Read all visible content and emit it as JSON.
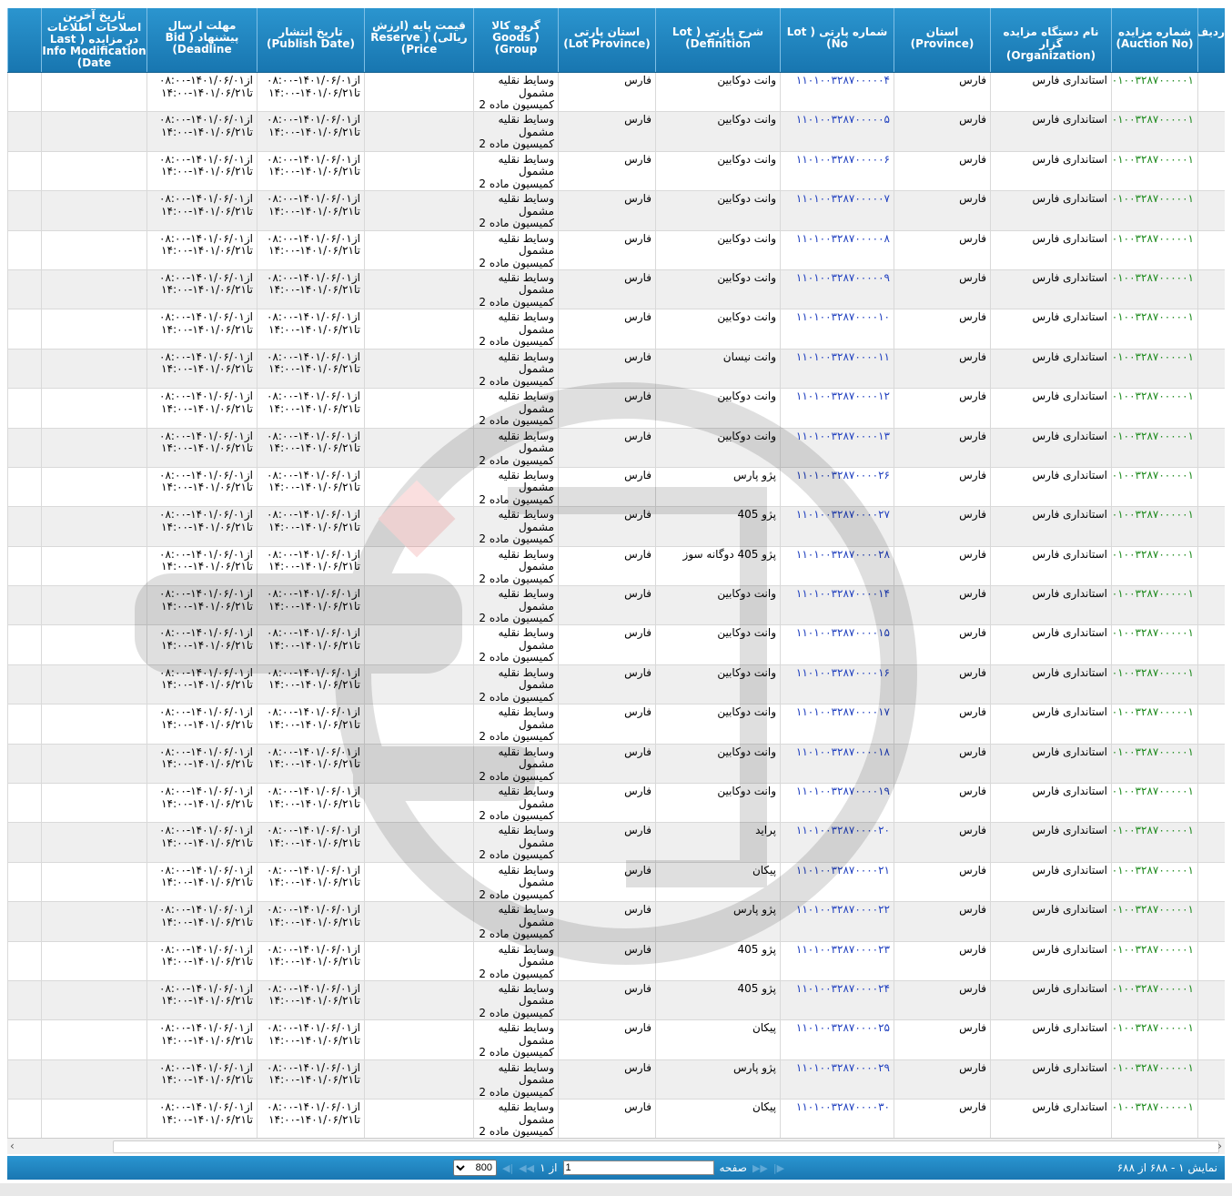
{
  "columns": [
    {
      "key": "row_no",
      "label": "ردیف",
      "width": 30
    },
    {
      "key": "auction_no",
      "label": "شماره مزایده\n(Auction No)",
      "width": 95
    },
    {
      "key": "organization",
      "label": "نام دستگاه مزایده گزار\n(Organization)",
      "width": 133
    },
    {
      "key": "province",
      "label": "استان\n(Province)",
      "width": 106
    },
    {
      "key": "lot_no",
      "label": "شماره پارتی ( Lot\nNo)",
      "width": 125
    },
    {
      "key": "definition",
      "label": "شرح پارتی ( Lot\nDefinition)",
      "width": 137
    },
    {
      "key": "lot_province",
      "label": "استان پارتی\n(Lot Province)",
      "width": 107
    },
    {
      "key": "goods_group",
      "label": "گروه کالا\n( Goods\nGroup)",
      "width": 93
    },
    {
      "key": "reserve_price",
      "label": "قیمت پایه (ارزش\nریالی) ( Reserve\nPrice)",
      "width": 120
    },
    {
      "key": "publish_date",
      "label": "تاریخ انتشار\n(Publish Date)",
      "width": 118
    },
    {
      "key": "deadline",
      "label": "مهلت ارسال\nپیشنهاد ( Bid\nDeadline)",
      "width": 121
    },
    {
      "key": "last_mod",
      "label": "تاریخ آخرین\nاصلاحات اطلاعات\nدر مزایده ( Last\nInfo Modification\nDate)",
      "width": 116
    },
    {
      "key": "extra",
      "label": "",
      "width": 37
    }
  ],
  "common": {
    "auction_no": "۱۰۰۱۰۰۳۲۸۷۰۰۰۰۰۱",
    "organization": "استانداری فارس",
    "province": "فارس",
    "lot_province": "فارس",
    "goods_group": "وسایط نقلیه\nمشمول\nکمیسیون ماده 2",
    "publish_date": "از۱۴۰۱/۰۶/۰۱-۰۸:۰۰\nتا۱۴۰۱/۰۶/۲۱-۱۴:۰۰",
    "deadline": "از۱۴۰۱/۰۶/۰۱-۰۸:۰۰\nتا۱۴۰۱/۰۶/۲۱-۱۴:۰۰"
  },
  "rows": [
    {
      "lot_no": "۱۱۰۱۰۰۳۲۸۷۰۰۰۰۰۴",
      "definition": "وانت دوکابین"
    },
    {
      "lot_no": "۱۱۰۱۰۰۳۲۸۷۰۰۰۰۰۵",
      "definition": "وانت دوکابین"
    },
    {
      "lot_no": "۱۱۰۱۰۰۳۲۸۷۰۰۰۰۰۶",
      "definition": "وانت دوکابین"
    },
    {
      "lot_no": "۱۱۰۱۰۰۳۲۸۷۰۰۰۰۰۷",
      "definition": "وانت دوکابین"
    },
    {
      "lot_no": "۱۱۰۱۰۰۳۲۸۷۰۰۰۰۰۸",
      "definition": "وانت دوکابین"
    },
    {
      "lot_no": "۱۱۰۱۰۰۳۲۸۷۰۰۰۰۰۹",
      "definition": "وانت دوکابین"
    },
    {
      "lot_no": "۱۱۰۱۰۰۳۲۸۷۰۰۰۰۱۰",
      "definition": "وانت دوکابین"
    },
    {
      "lot_no": "۱۱۰۱۰۰۳۲۸۷۰۰۰۰۱۱",
      "definition": "وانت نیسان"
    },
    {
      "lot_no": "۱۱۰۱۰۰۳۲۸۷۰۰۰۰۱۲",
      "definition": "وانت دوکابین"
    },
    {
      "lot_no": "۱۱۰۱۰۰۳۲۸۷۰۰۰۰۱۳",
      "definition": "وانت دوکابین"
    },
    {
      "lot_no": "۱۱۰۱۰۰۳۲۸۷۰۰۰۰۲۶",
      "definition": "پژو پارس"
    },
    {
      "lot_no": "۱۱۰۱۰۰۳۲۸۷۰۰۰۰۲۷",
      "definition": "پژو 405"
    },
    {
      "lot_no": "۱۱۰۱۰۰۳۲۸۷۰۰۰۰۲۸",
      "definition": "پژو 405 دوگانه سوز"
    },
    {
      "lot_no": "۱۱۰۱۰۰۳۲۸۷۰۰۰۰۱۴",
      "definition": "وانت دوکابین"
    },
    {
      "lot_no": "۱۱۰۱۰۰۳۲۸۷۰۰۰۰۱۵",
      "definition": "وانت دوکابین"
    },
    {
      "lot_no": "۱۱۰۱۰۰۳۲۸۷۰۰۰۰۱۶",
      "definition": "وانت دوکابین"
    },
    {
      "lot_no": "۱۱۰۱۰۰۳۲۸۷۰۰۰۰۱۷",
      "definition": "وانت دوکابین"
    },
    {
      "lot_no": "۱۱۰۱۰۰۳۲۸۷۰۰۰۰۱۸",
      "definition": "وانت دوکابین"
    },
    {
      "lot_no": "۱۱۰۱۰۰۳۲۸۷۰۰۰۰۱۹",
      "definition": "وانت دوکابین"
    },
    {
      "lot_no": "۱۱۰۱۰۰۳۲۸۷۰۰۰۰۲۰",
      "definition": "پراید"
    },
    {
      "lot_no": "۱۱۰۱۰۰۳۲۸۷۰۰۰۰۲۱",
      "definition": "پیکان"
    },
    {
      "lot_no": "۱۱۰۱۰۰۳۲۸۷۰۰۰۰۲۲",
      "definition": "پژو پارس"
    },
    {
      "lot_no": "۱۱۰۱۰۰۳۲۸۷۰۰۰۰۲۳",
      "definition": "پژو 405"
    },
    {
      "lot_no": "۱۱۰۱۰۰۳۲۸۷۰۰۰۰۲۴",
      "definition": "پژو 405"
    },
    {
      "lot_no": "۱۱۰۱۰۰۳۲۸۷۰۰۰۰۲۵",
      "definition": "پیکان"
    },
    {
      "lot_no": "۱۱۰۱۰۰۳۲۸۷۰۰۰۰۲۹",
      "definition": "پژو پارس"
    },
    {
      "lot_no": "۱۱۰۱۰۰۳۲۸۷۰۰۰۰۳۰",
      "definition": "پیکان"
    }
  ],
  "footer": {
    "summary": "نمایش ۱ - ۶۸۸ از ۶۸۸",
    "page_label": "صفحه",
    "page_value": "1",
    "of_label": "از ۱",
    "page_size": "800"
  },
  "colors": {
    "header": "#1f84c0",
    "auction_no": "#1d8a1d",
    "lot_no": "#1f3fbf"
  }
}
